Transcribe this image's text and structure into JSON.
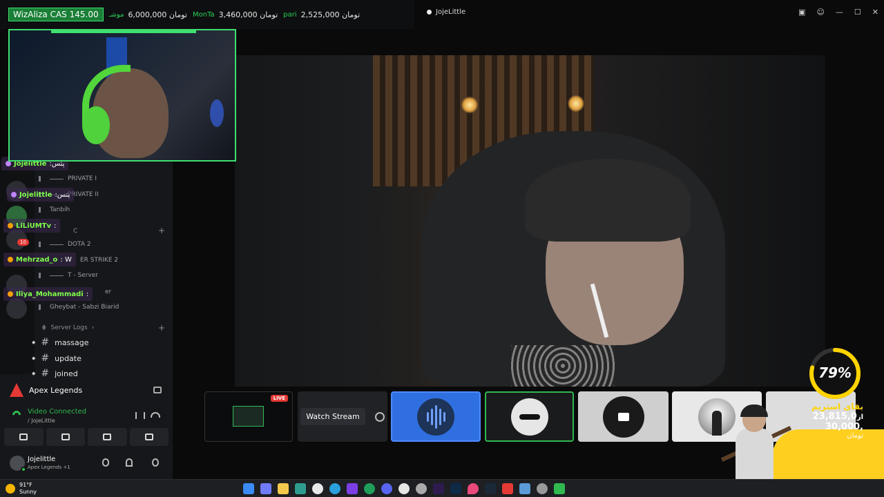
{
  "ticker": {
    "highlight": "WizAliza CAS 145.00",
    "items": [
      {
        "name": "موشـ",
        "amount": "6,000,000 تومان"
      },
      {
        "name": "MonTa",
        "amount": "3,460,000 تومان"
      },
      {
        "name": "pari",
        "amount": "2,525,000 تومان"
      }
    ]
  },
  "window": {
    "title": "JojeLittle",
    "controls": [
      "▣",
      "☺",
      "—",
      "☐",
      "✕"
    ]
  },
  "rail": {
    "badge": "10"
  },
  "channels": {
    "voice": [
      "PRIVATE I",
      "PRIVATE II",
      "Tanbih",
      "DOTA 2",
      "ER STRIKE 2",
      "T - Server",
      "er",
      "Gheybat - Sabzi Biarid"
    ],
    "categories": [
      "C",
      "Server Logs"
    ],
    "text": [
      "massage",
      "update",
      "joined"
    ]
  },
  "chat": [
    {
      "user": "Jojelittle",
      "msg": ":پتس"
    },
    {
      "user": "Jojelittle",
      "msg": ":پتس"
    },
    {
      "user": "LiLiUMTv",
      "msg": ":"
    },
    {
      "user": "Mehrzad_o",
      "msg": ": W"
    },
    {
      "user": "Iliya_Mohammadi",
      "msg": ":"
    }
  ],
  "tiles": {
    "live": "LIVE",
    "watch": "Watch Stream"
  },
  "goal": {
    "percent": "79%",
    "progress": 0.79,
    "label": "بقای استریم",
    "current": "23,815,0",
    "current_suffix": "از",
    "target": "30,000,",
    "currency": "تومان"
  },
  "activity": {
    "game": "Apex Legends"
  },
  "voice": {
    "status": "Video Connected",
    "sub": "/ JojeLittle"
  },
  "user": {
    "name": "Jojelittle",
    "activity": "Apex Legends +1"
  },
  "weather": {
    "temp": "91°F",
    "cond": "Sunny"
  },
  "colors": {
    "green": "#3fe06f",
    "live": "#e53935",
    "goal": "#ffd400",
    "blueTile": "#2f6fe0"
  }
}
